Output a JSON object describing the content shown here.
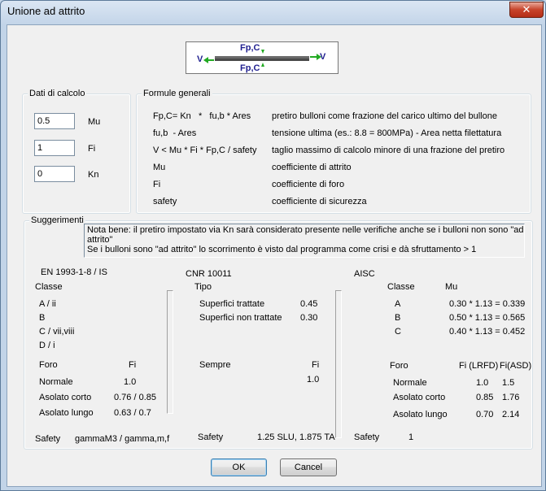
{
  "window": {
    "title": "Unione ad attrito",
    "close_glyph": "✕"
  },
  "diagram": {
    "top_label": "Fp,C",
    "bottom_label": "Fp,C",
    "left_label": "V",
    "right_label": "V"
  },
  "dati": {
    "legend": "Dati di calcolo",
    "fields": [
      {
        "value": "0.5",
        "label": "Mu"
      },
      {
        "value": "1",
        "label": "Fi"
      },
      {
        "value": "0",
        "label": "Kn"
      }
    ]
  },
  "formule": {
    "legend": "Formule generali",
    "rows": [
      {
        "formula": "Fp,C= Kn   *   fu,b * Ares",
        "desc": "pretiro bulloni come frazione del carico ultimo del bullone"
      },
      {
        "formula": "fu,b  - Ares",
        "desc": "tensione ultima (es.: 8.8 = 800MPa) - Area netta filettatura"
      },
      {
        "formula": "V < Mu * Fi * Fp,C / safety",
        "desc": "taglio massimo di calcolo minore di una frazione del pretiro"
      },
      {
        "formula": "Mu",
        "desc": "coefficiente di attrito"
      },
      {
        "formula": "Fi",
        "desc": "coefficiente di foro"
      },
      {
        "formula": "safety",
        "desc": "coefficiente di sicurezza"
      }
    ]
  },
  "sugg": {
    "legend": "Suggerimenti",
    "note_line1": "Nota bene: il pretiro impostato via Kn sarà considerato presente nelle verifiche anche se i bulloni non sono \"ad",
    "note_line2": "attrito\"",
    "note_line3": "Se i bulloni sono \"ad attrito\" lo scorrimento è visto dal programma come crisi e dà sfruttamento > 1",
    "en": {
      "title": "EN 1993-1-8 / IS",
      "classe_label": "Classe",
      "classes": [
        "A / ii",
        "B",
        "C / vii,viii",
        "D / i"
      ],
      "foro_label": "Foro",
      "fi_label": "Fi",
      "fori": [
        {
          "name": "Normale",
          "val": "1.0"
        },
        {
          "name": "Asolato corto",
          "val": "0.76 / 0.85"
        },
        {
          "name": "Asolato lungo",
          "val": "0.63 / 0.7"
        }
      ],
      "safety_label": "Safety",
      "safety_val": "gammaM3 / gamma,m,f"
    },
    "cnr": {
      "title": "CNR 10011",
      "tipo_label": "Tipo",
      "tipi": [
        {
          "name": "Superfici trattate",
          "val": "0.45"
        },
        {
          "name": "Superfici non trattate",
          "val": "0.30"
        }
      ],
      "sempre_label": "Sempre",
      "fi_label": "Fi",
      "fi_val": "1.0",
      "safety_label": "Safety",
      "safety_val": "1.25 SLU, 1.875 TA"
    },
    "aisc": {
      "title": "AISC",
      "classe_label": "Classe",
      "mu_label": "Mu",
      "classes": [
        {
          "name": "A",
          "val": "0.30 * 1.13 = 0.339"
        },
        {
          "name": "B",
          "val": "0.50 * 1.13 = 0.565"
        },
        {
          "name": "C",
          "val": "0.40 * 1.13 = 0.452"
        }
      ],
      "foro_label": "Foro",
      "fi_lrfd_label": "Fi (LRFD)",
      "fi_asd_label": "Fi(ASD)",
      "fori": [
        {
          "name": "Normale",
          "lrfd": "1.0",
          "asd": "1.5"
        },
        {
          "name": "Asolato corto",
          "lrfd": "0.85",
          "asd": "1.76"
        },
        {
          "name": "Asolato lungo",
          "lrfd": "0.70",
          "asd": "2.14"
        }
      ],
      "safety_label": "Safety",
      "safety_val": "1"
    }
  },
  "buttons": {
    "ok": "OK",
    "cancel": "Cancel"
  },
  "colors": {
    "label_blue": "#1f1f8f",
    "arrow_green": "#22aa22"
  }
}
